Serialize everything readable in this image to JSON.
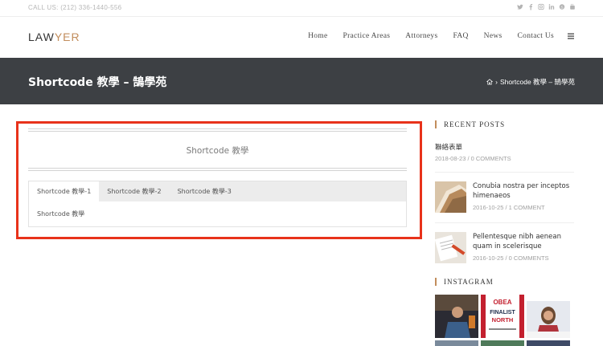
{
  "topbar": {
    "call": "CALL US: (212) 336-1440-556",
    "social_icons": [
      "twitter-icon",
      "facebook-icon",
      "instagram-icon",
      "linkedin-icon",
      "skype-icon",
      "youtube-icon"
    ]
  },
  "header": {
    "logo_part1": "LAW",
    "logo_part2": "YER",
    "nav": [
      "Home",
      "Practice Areas",
      "Attorneys",
      "FAQ",
      "News",
      "Contact Us"
    ]
  },
  "page_header": {
    "title": "Shortcode 教學 – 鵠學苑",
    "breadcrumb": "Shortcode 教學 – 鵠學苑"
  },
  "main": {
    "section_title": "Shortcode 教學",
    "tabs": [
      "Shortcode 教學-1",
      "Shortcode 教學-2",
      "Shortcode 教學-3"
    ],
    "tab_content": "Shortcode 教學"
  },
  "sidebar": {
    "recent_title": "RECENT POSTS",
    "posts": [
      {
        "title": "聯絡表單",
        "date": "2018-08-23",
        "comments": "0 COMMENTS"
      },
      {
        "title": "Conubia nostra per inceptos himenaeos",
        "date": "2016-10-25",
        "comments": "1 COMMENT"
      },
      {
        "title": "Pellentesque nibh aenean quam in scelerisque",
        "date": "2016-10-25",
        "comments": "0 COMMENTS"
      }
    ],
    "instagram_title": "INSTAGRAM",
    "instagram_text": {
      "line1": "FINALIST",
      "line2": "NORTH",
      "badge": "OBEA"
    }
  },
  "colors": {
    "accent": "#c28d5c",
    "header_bg": "#3d4044",
    "highlight": "#e8321a"
  }
}
